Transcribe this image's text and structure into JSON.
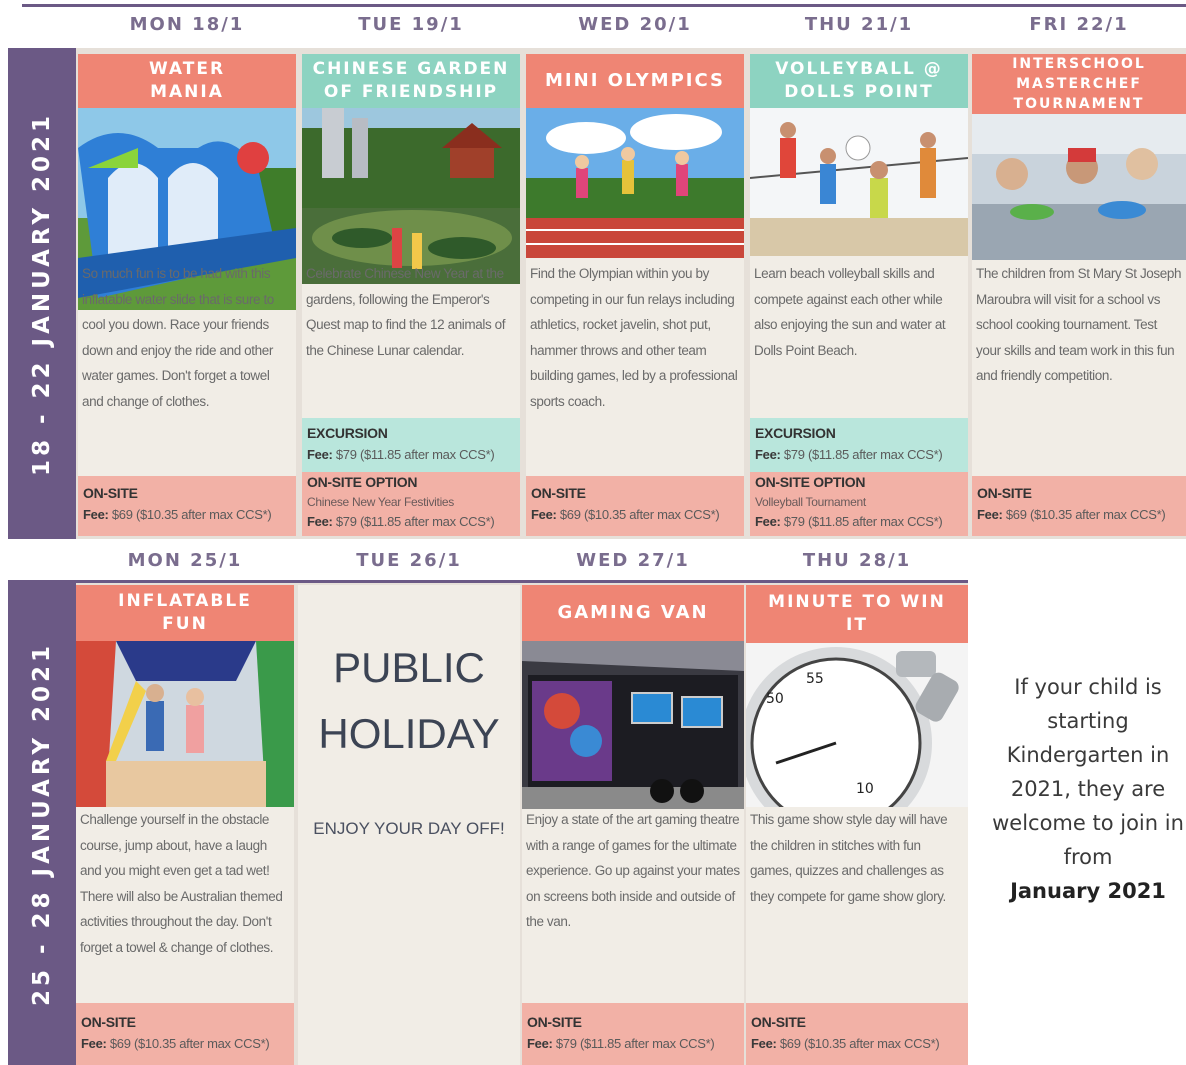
{
  "week1": {
    "label": "18 - 22 JANUARY 2021",
    "days": [
      {
        "date": "MON 18/1",
        "title": "WATER MANIA",
        "title_color": "#ef8574",
        "image": "inflatable-water-slide",
        "description": "So much fun is to be had with this inflatable water slide that is sure to cool you down. Race your friends down and enjoy the ride and other water games. Don't forget a towel and change of clothes.",
        "bands": [
          {
            "type": "ON-SITE",
            "label": "ON-SITE",
            "fee_label": "Fee:",
            "fee": "$69 ($10.35 after max CCS*)"
          }
        ]
      },
      {
        "date": "TUE 19/1",
        "title": "CHINESE GARDEN OF FRIENDSHIP",
        "title_color": "#8dd3c1",
        "image": "chinese-garden-pond",
        "description": "Celebrate Chinese New Year at the gardens, following the Emperor's Quest map to find the 12 animals of the Chinese Lunar calendar.",
        "bands": [
          {
            "type": "EXCURSION",
            "label": "EXCURSION",
            "fee_label": "Fee:",
            "fee": "$79 ($11.85 after max CCS*)"
          },
          {
            "type": "ON-SITE OPTION",
            "label": "ON-SITE OPTION",
            "sub": "Chinese New Year Festivities",
            "fee_label": "Fee:",
            "fee": "$79 ($11.85 after max CCS*)"
          }
        ]
      },
      {
        "date": "WED 20/1",
        "title": "MINI OLYMPICS",
        "title_color": "#ef8574",
        "image": "kids-running-track",
        "description": "Find the Olympian within you by competing in our fun relays including athletics, rocket javelin, shot put, hammer throws and other team building games, led by a professional sports coach.",
        "bands": [
          {
            "type": "ON-SITE",
            "label": "ON-SITE",
            "fee_label": "Fee:",
            "fee": "$69 ($10.35 after max CCS*)"
          }
        ]
      },
      {
        "date": "THU 21/1",
        "title": "VOLLEYBALL @ DOLLS POINT",
        "title_color": "#8dd3c1",
        "image": "beach-volleyball-kids",
        "description": "Learn beach volleyball skills and compete against each other while also enjoying the sun and water at Dolls Point Beach.",
        "bands": [
          {
            "type": "EXCURSION",
            "label": "EXCURSION",
            "fee_label": "Fee:",
            "fee": "$79 ($11.85 after max CCS*)"
          },
          {
            "type": "ON-SITE OPTION",
            "label": "ON-SITE OPTION",
            "sub": "Volleyball Tournament",
            "fee_label": "Fee:",
            "fee": "$79 ($11.85 after max CCS*)"
          }
        ]
      },
      {
        "date": "FRI 22/1",
        "title": "INTERSCHOOL MASTERCHEF TOURNAMENT",
        "title_color": "#ef8574",
        "image": "kids-cooking",
        "description": "The children from St Mary St Joseph Maroubra will visit for a school vs school cooking tournament. Test your skills and team work in this fun and friendly competition.",
        "bands": [
          {
            "type": "ON-SITE",
            "label": "ON-SITE",
            "fee_label": "Fee:",
            "fee": "$69 ($10.35 after max CCS*)"
          }
        ]
      }
    ]
  },
  "week2": {
    "label": "25 - 28 JANUARY 2021",
    "days": [
      {
        "date": "MON 25/1",
        "title": "INFLATABLE FUN",
        "title_color": "#ef8574",
        "image": "bouncy-castle-kids",
        "description": "Challenge yourself in the obstacle course, jump about, have a laugh and you might even get a tad wet! There will also be Australian themed activities throughout the day. Don't forget a towel & change of clothes.",
        "bands": [
          {
            "type": "ON-SITE",
            "label": "ON-SITE",
            "fee_label": "Fee:",
            "fee": "$69 ($10.35 after max CCS*)"
          }
        ]
      },
      {
        "date": "TUE 26/1",
        "holiday_line1": "PUBLIC",
        "holiday_line2": "HOLIDAY",
        "holiday_sub": "ENJOY YOUR DAY OFF!"
      },
      {
        "date": "WED 27/1",
        "title": "GAMING VAN",
        "title_color": "#ef8574",
        "image": "gaming-van-trailer",
        "description": "Enjoy a state of the art gaming theatre with a range of games for the ultimate experience. Go up against your mates on screens both inside and outside of the van.",
        "bands": [
          {
            "type": "ON-SITE",
            "label": "ON-SITE",
            "fee_label": "Fee:",
            "fee": "$79 ($11.85 after max CCS*)"
          }
        ]
      },
      {
        "date": "THU 28/1",
        "title": "MINUTE TO WIN IT",
        "title_color": "#ef8574",
        "image": "stopwatch",
        "description": "This game show style day will have the children in stitches with fun games, quizzes and challenges as they compete for game show glory.",
        "bands": [
          {
            "type": "ON-SITE",
            "label": "ON-SITE",
            "fee_label": "Fee:",
            "fee": "$69 ($10.35 after max CCS*)"
          }
        ]
      }
    ]
  },
  "kinder_note": {
    "text": "If your child is starting Kindergarten in 2021, they are welcome to join in from",
    "emphasis": "January 2021"
  },
  "colors": {
    "purple": "#6b5985",
    "salmon": "#ef8574",
    "teal": "#8dd3c1",
    "pink_band": "#f2b1a6",
    "teal_band": "#b9e6dc",
    "cell_bg": "#f1ede6"
  }
}
